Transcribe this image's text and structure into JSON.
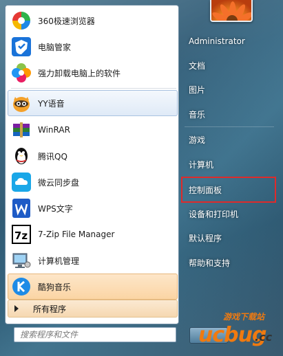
{
  "programs": [
    {
      "name": "360-browser",
      "label": "360极速浏览器",
      "icon": "360-browser-icon"
    },
    {
      "name": "pc-manager",
      "label": "电脑管家",
      "icon": "shield-icon"
    },
    {
      "name": "uninstaller",
      "label": "强力卸载电脑上的软件",
      "icon": "flower-icon"
    },
    {
      "name": "yy-voice",
      "label": "YY语音",
      "icon": "yy-raccoon-icon"
    },
    {
      "name": "winrar",
      "label": "WinRAR",
      "icon": "winrar-books-icon"
    },
    {
      "name": "qq",
      "label": "腾讯QQ",
      "icon": "penguin-icon"
    },
    {
      "name": "weiyun",
      "label": "微云同步盘",
      "icon": "cloud-icon"
    },
    {
      "name": "wps",
      "label": "WPS文字",
      "icon": "wps-w-icon"
    },
    {
      "name": "7zip",
      "label": "7-Zip File Manager",
      "icon": "7z-icon"
    },
    {
      "name": "computer-management",
      "label": "计算机管理",
      "icon": "computer-management-icon"
    },
    {
      "name": "kugou",
      "label": "酷狗音乐",
      "icon": "kugou-k-icon"
    }
  ],
  "all_programs": "所有程序",
  "search": {
    "placeholder": "搜索程序和文件"
  },
  "right": {
    "user": "Administrator",
    "links": [
      "文档",
      "图片",
      "音乐",
      "游戏",
      "计算机",
      "控制面板",
      "设备和打印机",
      "默认程序",
      "帮助和支持"
    ]
  },
  "watermark": {
    "main": "ucbug",
    "cc": ".cc",
    "cn": "游戏下载站"
  },
  "colors": {
    "highlight_box": "#e02a2a",
    "hover_item": "#dfeaf7",
    "kugou_item": "#fbd5a4"
  }
}
